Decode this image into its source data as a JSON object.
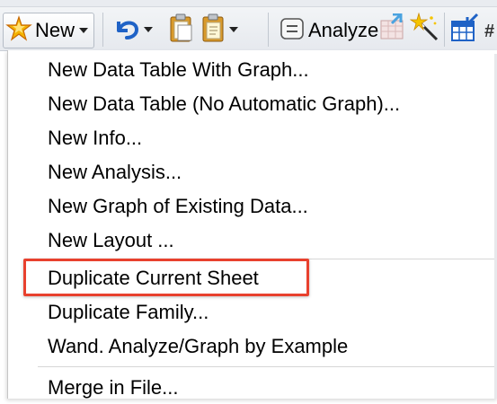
{
  "toolbar": {
    "new_label": "New",
    "analyze_label": "Analyze",
    "overflow_glyph": "#",
    "icons": [
      "new-star-icon",
      "undo-icon",
      "clipboard-copy-icon",
      "clipboard-paste-icon",
      "analyze-icon",
      "table-graph-icon",
      "magic-wand-icon",
      "insert-table-icon"
    ],
    "colors": {
      "star": "#f5b400",
      "undo": "#1f62c6",
      "highlight": "#e8412e"
    }
  },
  "menu": {
    "items": [
      {
        "label": "New Data Table With Graph..."
      },
      {
        "label": "New Data Table (No Automatic Graph)..."
      },
      {
        "label": "New Info..."
      },
      {
        "label": "New Analysis..."
      },
      {
        "label": "New Graph of Existing Data..."
      },
      {
        "label": "New Layout ..."
      },
      {
        "label": "Duplicate Current Sheet"
      },
      {
        "label": "Duplicate Family..."
      },
      {
        "label": "Wand. Analyze/Graph by Example"
      },
      {
        "label": "Merge in File..."
      }
    ],
    "highlighted_index": 6
  }
}
